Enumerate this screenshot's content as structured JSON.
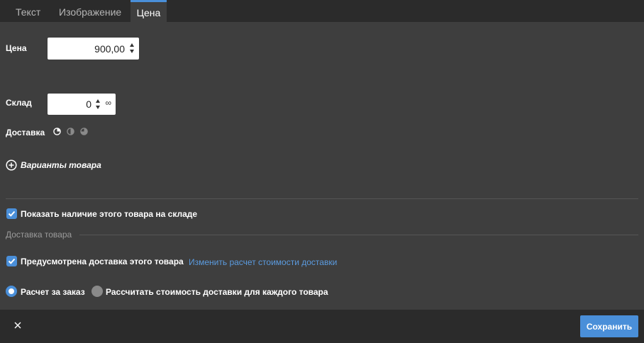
{
  "tabs": [
    {
      "label": "Текст"
    },
    {
      "label": "Изображение"
    },
    {
      "label": "Цена"
    }
  ],
  "price": {
    "label": "Цена",
    "value": "900,00"
  },
  "stock": {
    "label": "Склад",
    "value": "0",
    "infinity": "∞"
  },
  "delivery": {
    "label": "Доставка",
    "icons": [
      "pie-quarter-icon",
      "pie-half-icon",
      "pie-three-quarter-icon"
    ]
  },
  "variants": {
    "label": "Варианты товара"
  },
  "show_stock": {
    "label": "Показать наличие этого товара на складе",
    "checked": true
  },
  "delivery_section": {
    "title": "Доставка товара",
    "provided": {
      "label": "Предусмотрена доставка этого товара",
      "checked": true
    },
    "change_link": "Изменить расчет стоимости доставки",
    "options": [
      {
        "label": "Расчет за заказ",
        "selected": true
      },
      {
        "label": "Рассчитать стоимость доставки для каждого товара",
        "selected": false
      }
    ]
  },
  "footer": {
    "save_label": "Сохранить"
  },
  "colors": {
    "accent": "#4a8fd9",
    "panel": "#3e3e3e",
    "bar": "#2b2b2b",
    "link": "#5b9bdf"
  }
}
